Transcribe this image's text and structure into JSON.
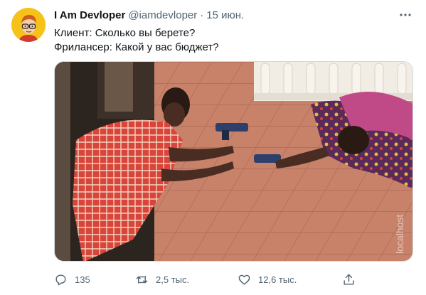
{
  "tweet": {
    "author_name": "I Am Devloper",
    "handle": "@iamdevloper",
    "separator": "·",
    "date": "15 июн.",
    "lines": [
      "Клиент: Сколько вы берете?",
      "Фрилансер: Какой у вас бюджет?"
    ],
    "media_watermark": "localhost"
  },
  "actions": {
    "reply_count": "135",
    "retweet_count": "2,5 тыс.",
    "like_count": "12,6 тыс."
  },
  "icons": {
    "more": "more-dots-icon",
    "reply": "reply-icon",
    "retweet": "retweet-icon",
    "like": "heart-icon",
    "share": "share-icon"
  },
  "colors": {
    "secondary_text": "#536471",
    "primary_text": "#0f1419",
    "avatar_bg": "#f6c21a"
  }
}
